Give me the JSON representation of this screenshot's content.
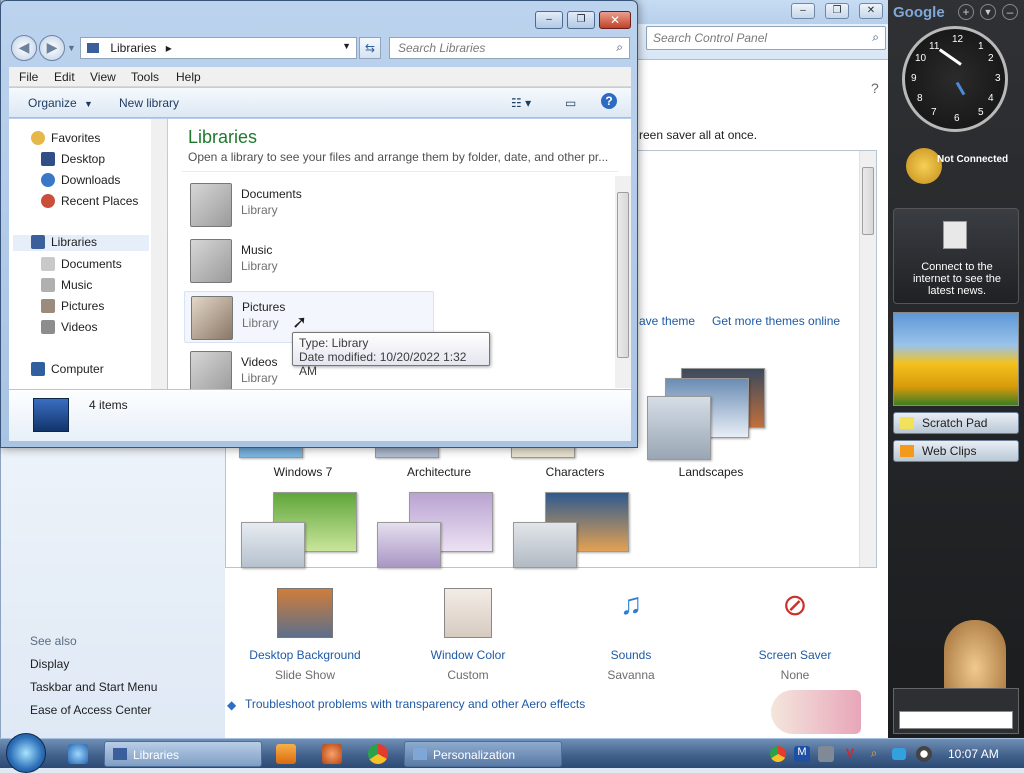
{
  "control_panel": {
    "search_placeholder": "Search Control Panel",
    "intro_text": "reen saver all at once.",
    "links": {
      "save_theme": "ave theme",
      "get_more_themes": "Get more themes online"
    },
    "themes": [
      {
        "label": "Windows 7"
      },
      {
        "label": "Architecture"
      },
      {
        "label": "Characters"
      },
      {
        "label": "Landscapes"
      }
    ],
    "bottom_items": [
      {
        "title": "Desktop Background",
        "sub": "Slide Show"
      },
      {
        "title": "Window Color",
        "sub": "Custom"
      },
      {
        "title": "Sounds",
        "sub": "Savanna"
      },
      {
        "title": "Screen Saver",
        "sub": "None"
      }
    ],
    "see_also": {
      "heading": "See also",
      "items": [
        "Display",
        "Taskbar and Start Menu",
        "Ease of Access Center"
      ]
    },
    "troubleshoot_link": "Troubleshoot problems with transparency and other Aero effects"
  },
  "libraries_window": {
    "address": "Libraries",
    "search_placeholder": "Search Libraries",
    "menu": [
      "File",
      "Edit",
      "View",
      "Tools",
      "Help"
    ],
    "toolbar": {
      "organize": "Organize",
      "new_library": "New library"
    },
    "nav": {
      "favorites": "Favorites",
      "favorites_items": [
        "Desktop",
        "Downloads",
        "Recent Places"
      ],
      "libraries": "Libraries",
      "libraries_items": [
        "Documents",
        "Music",
        "Pictures",
        "Videos"
      ],
      "computer": "Computer"
    },
    "title": "Libraries",
    "subtitle": "Open a library to see your files and arrange them by folder, date, and other pr...",
    "items": [
      {
        "name": "Documents",
        "type": "Library"
      },
      {
        "name": "Music",
        "type": "Library"
      },
      {
        "name": "Pictures",
        "type": "Library"
      },
      {
        "name": "Videos",
        "type": "Library"
      }
    ],
    "details": "4 items",
    "tooltip": {
      "line1": "Type: Library",
      "line2": "Date modified: 10/20/2022 1:32 AM"
    }
  },
  "sidebar": {
    "brand": "Google",
    "weather_status": "Not Connected",
    "news_text": "Connect to the internet to see the latest news.",
    "scratch_pad": "Scratch Pad",
    "web_clips": "Web Clips",
    "clock_numbers": [
      "12",
      "1",
      "2",
      "3",
      "4",
      "5",
      "6",
      "7",
      "8",
      "9",
      "10",
      "11"
    ]
  },
  "taskbar": {
    "libraries_btn": "Libraries",
    "personalization_btn": "Personalization",
    "time": "10:07 AM"
  }
}
